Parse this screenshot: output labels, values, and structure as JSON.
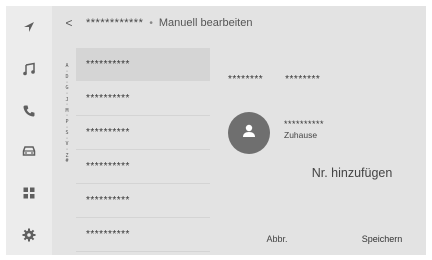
{
  "nav": {
    "items": [
      {
        "id": "navigation",
        "icon": "navigation-arrow-icon"
      },
      {
        "id": "media",
        "icon": "music-note-icon"
      },
      {
        "id": "phone",
        "icon": "phone-icon"
      },
      {
        "id": "vehicle",
        "icon": "car-icon"
      },
      {
        "id": "apps",
        "icon": "apps-grid-icon"
      },
      {
        "id": "settings",
        "icon": "gear-icon"
      }
    ]
  },
  "header": {
    "back_glyph": "<",
    "contact_name": "************",
    "separator": "•",
    "title": "Manuell bearbeiten"
  },
  "index_letters": [
    "A",
    "·",
    "D",
    "·",
    "G",
    "·",
    "J",
    "·",
    "M",
    "·",
    "P",
    "·",
    "S",
    "·",
    "V",
    "·",
    "Z",
    "#"
  ],
  "contact_list": [
    "**********",
    "**********",
    "**********",
    "**********",
    "**********",
    "**********"
  ],
  "detail": {
    "phone_numbers": [
      "********",
      "********"
    ],
    "contact_name": "**********",
    "contact_type": "Zuhause",
    "add_number_label": "Nr. hinzufügen",
    "cancel_label": "Abbr.",
    "save_label": "Speichern"
  },
  "colors": {
    "background": "#e3e3e3",
    "sidebar": "#ececec",
    "selected_row": "#d5d5d5",
    "avatar": "#6f6f6f"
  }
}
